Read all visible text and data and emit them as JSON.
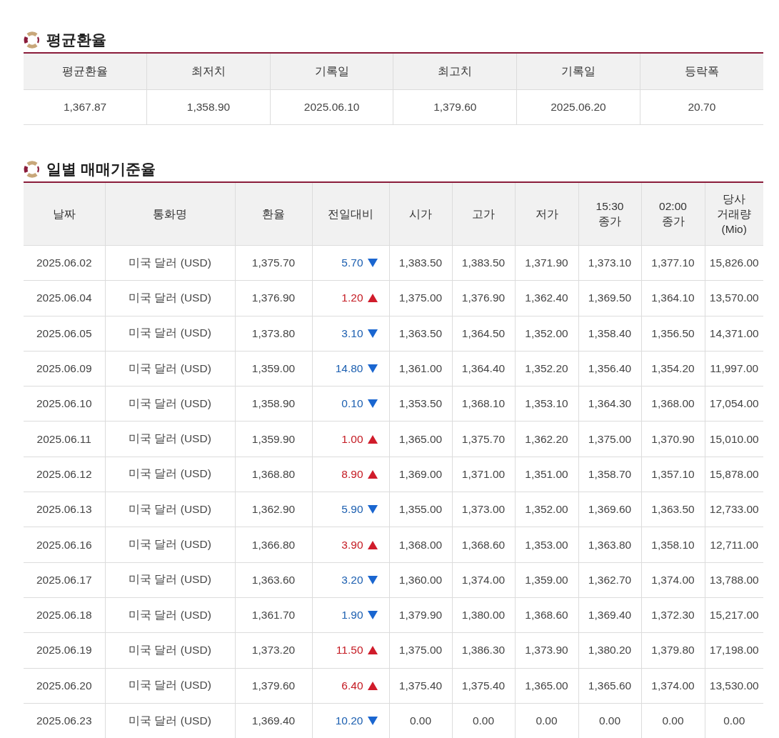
{
  "average_section": {
    "title": "평균환율",
    "columns": [
      "평균환율",
      "최저치",
      "기록일",
      "최고치",
      "기록일",
      "등락폭"
    ],
    "values": [
      "1,367.87",
      "1,358.90",
      "2025.06.10",
      "1,379.60",
      "2025.06.20",
      "20.70"
    ]
  },
  "daily_section": {
    "title": "일별 매매기준율",
    "columns": [
      "날짜",
      "통화명",
      "환율",
      "전일대비",
      "시가",
      "고가",
      "저가",
      "15:30\n종가",
      "02:00\n종가",
      "당사\n거래량\n(Mio)"
    ],
    "rows": [
      {
        "date": "2025.06.02",
        "currency": "미국 달러 (USD)",
        "rate": "1,375.70",
        "change": "5.70",
        "kind": "down",
        "open": "1,383.50",
        "high": "1,383.50",
        "low": "1,371.90",
        "close_1530": "1,373.10",
        "close_0200": "1,377.10",
        "volume": "15,826.00"
      },
      {
        "date": "2025.06.04",
        "currency": "미국 달러 (USD)",
        "rate": "1,376.90",
        "change": "1.20",
        "kind": "up",
        "open": "1,375.00",
        "high": "1,376.90",
        "low": "1,362.40",
        "close_1530": "1,369.50",
        "close_0200": "1,364.10",
        "volume": "13,570.00"
      },
      {
        "date": "2025.06.05",
        "currency": "미국 달러 (USD)",
        "rate": "1,373.80",
        "change": "3.10",
        "kind": "down",
        "open": "1,363.50",
        "high": "1,364.50",
        "low": "1,352.00",
        "close_1530": "1,358.40",
        "close_0200": "1,356.50",
        "volume": "14,371.00"
      },
      {
        "date": "2025.06.09",
        "currency": "미국 달러 (USD)",
        "rate": "1,359.00",
        "change": "14.80",
        "kind": "down",
        "open": "1,361.00",
        "high": "1,364.40",
        "low": "1,352.20",
        "close_1530": "1,356.40",
        "close_0200": "1,354.20",
        "volume": "11,997.00"
      },
      {
        "date": "2025.06.10",
        "currency": "미국 달러 (USD)",
        "rate": "1,358.90",
        "change": "0.10",
        "kind": "down",
        "open": "1,353.50",
        "high": "1,368.10",
        "low": "1,353.10",
        "close_1530": "1,364.30",
        "close_0200": "1,368.00",
        "volume": "17,054.00"
      },
      {
        "date": "2025.06.11",
        "currency": "미국 달러 (USD)",
        "rate": "1,359.90",
        "change": "1.00",
        "kind": "up",
        "open": "1,365.00",
        "high": "1,375.70",
        "low": "1,362.20",
        "close_1530": "1,375.00",
        "close_0200": "1,370.90",
        "volume": "15,010.00"
      },
      {
        "date": "2025.06.12",
        "currency": "미국 달러 (USD)",
        "rate": "1,368.80",
        "change": "8.90",
        "kind": "up",
        "open": "1,369.00",
        "high": "1,371.00",
        "low": "1,351.00",
        "close_1530": "1,358.70",
        "close_0200": "1,357.10",
        "volume": "15,878.00"
      },
      {
        "date": "2025.06.13",
        "currency": "미국 달러 (USD)",
        "rate": "1,362.90",
        "change": "5.90",
        "kind": "down",
        "open": "1,355.00",
        "high": "1,373.00",
        "low": "1,352.00",
        "close_1530": "1,369.60",
        "close_0200": "1,363.50",
        "volume": "12,733.00"
      },
      {
        "date": "2025.06.16",
        "currency": "미국 달러 (USD)",
        "rate": "1,366.80",
        "change": "3.90",
        "kind": "up",
        "open": "1,368.00",
        "high": "1,368.60",
        "low": "1,353.00",
        "close_1530": "1,363.80",
        "close_0200": "1,358.10",
        "volume": "12,711.00"
      },
      {
        "date": "2025.06.17",
        "currency": "미국 달러 (USD)",
        "rate": "1,363.60",
        "change": "3.20",
        "kind": "down",
        "open": "1,360.00",
        "high": "1,374.00",
        "low": "1,359.00",
        "close_1530": "1,362.70",
        "close_0200": "1,374.00",
        "volume": "13,788.00"
      },
      {
        "date": "2025.06.18",
        "currency": "미국 달러 (USD)",
        "rate": "1,361.70",
        "change": "1.90",
        "kind": "down",
        "open": "1,379.90",
        "high": "1,380.00",
        "low": "1,368.60",
        "close_1530": "1,369.40",
        "close_0200": "1,372.30",
        "volume": "15,217.00"
      },
      {
        "date": "2025.06.19",
        "currency": "미국 달러 (USD)",
        "rate": "1,373.20",
        "change": "11.50",
        "kind": "up",
        "open": "1,375.00",
        "high": "1,386.30",
        "low": "1,373.90",
        "close_1530": "1,380.20",
        "close_0200": "1,379.80",
        "volume": "17,198.00"
      },
      {
        "date": "2025.06.20",
        "currency": "미국 달러 (USD)",
        "rate": "1,379.60",
        "change": "6.40",
        "kind": "up",
        "open": "1,375.40",
        "high": "1,375.40",
        "low": "1,365.00",
        "close_1530": "1,365.60",
        "close_0200": "1,374.00",
        "volume": "13,530.00"
      },
      {
        "date": "2025.06.23",
        "currency": "미국 달러 (USD)",
        "rate": "1,369.40",
        "change": "10.20",
        "kind": "down",
        "open": "0.00",
        "high": "0.00",
        "low": "0.00",
        "close_1530": "0.00",
        "close_0200": "0.00",
        "volume": "0.00"
      }
    ]
  }
}
